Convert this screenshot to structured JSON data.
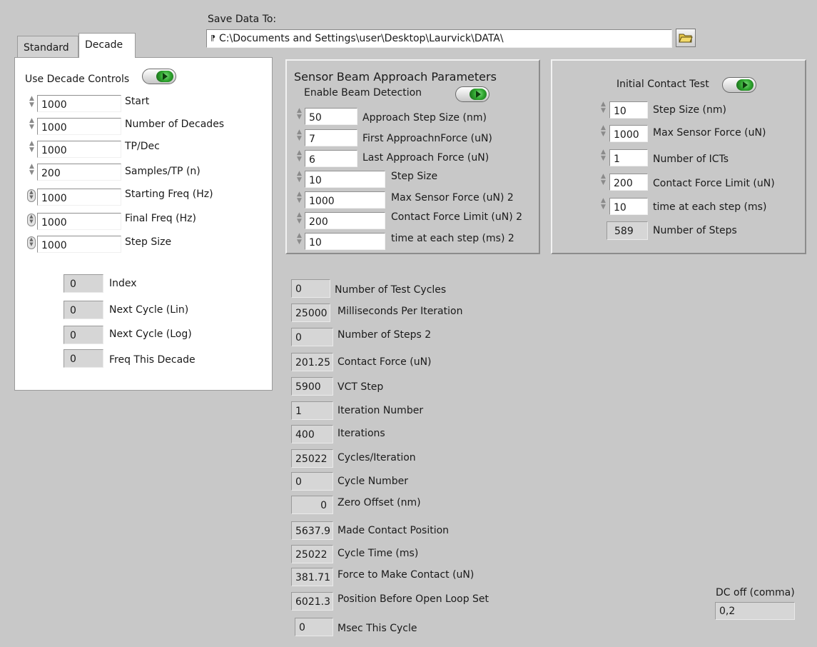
{
  "save": {
    "label": "Save Data To:",
    "path_icon": "path-icon",
    "path": "C:\\Documents and Settings\\user\\Desktop\\Laurvick\\DATA\\",
    "browse_icon": "folder-icon"
  },
  "tabs": [
    {
      "label": "Standard",
      "selected": false
    },
    {
      "label": "Decade",
      "selected": true
    }
  ],
  "decade": {
    "use_label": "Use Decade Controls",
    "controls": [
      {
        "value": "1000",
        "label": "Start"
      },
      {
        "value": "1000",
        "label": "Number of Decades"
      },
      {
        "value": "1000",
        "label": "TP/Dec"
      },
      {
        "value": "200",
        "label": "Samples/TP (n)"
      },
      {
        "value": "1000",
        "label": "Starting Freq (Hz)"
      },
      {
        "value": "1000",
        "label": "Final Freq (Hz)"
      },
      {
        "value": "1000",
        "label": "Step Size"
      }
    ],
    "indicators": [
      {
        "value": "0",
        "label": "Index"
      },
      {
        "value": "0",
        "label": "Next Cycle (Lin)"
      },
      {
        "value": "0",
        "label": "Next Cycle (Log)"
      },
      {
        "value": "0",
        "label": "Freq This Decade"
      }
    ]
  },
  "sensor": {
    "title": "Sensor Beam Approach  Parameters",
    "enable_label": "Enable Beam Detection",
    "controls": [
      {
        "value": "50",
        "label": "Approach Step Size (nm)"
      },
      {
        "value": "7",
        "label": "First ApproachnForce (uN)"
      },
      {
        "value": "6",
        "label": "Last Approach Force (uN)"
      },
      {
        "value": "10",
        "label": "Step Size"
      },
      {
        "value": "1000",
        "label": "Max Sensor Force (uN) 2"
      },
      {
        "value": "200",
        "label": "Contact Force Limit (uN) 2"
      },
      {
        "value": "10",
        "label": "time at each step (ms) 2"
      }
    ]
  },
  "ict": {
    "title": "Initial Contact Test",
    "controls": [
      {
        "value": "10",
        "label": "Step Size (nm)"
      },
      {
        "value": "1000",
        "label": "Max Sensor Force (uN)"
      },
      {
        "value": "1",
        "label": "Number of ICTs"
      },
      {
        "value": "200",
        "label": "Contact Force Limit (uN)"
      },
      {
        "value": "10",
        "label": "time at each step (ms)"
      }
    ],
    "steps": {
      "value": "589",
      "label": "Number of Steps"
    }
  },
  "status": [
    {
      "value": "0",
      "label": "Number of Test Cycles"
    },
    {
      "value": "25000",
      "label": "Milliseconds Per Iteration"
    },
    {
      "value": "0",
      "label": "Number of Steps 2"
    },
    {
      "value": "201.25",
      "label": "Contact Force (uN)"
    },
    {
      "value": "5900",
      "label": "VCT Step"
    },
    {
      "value": "1",
      "label": "Iteration Number"
    },
    {
      "value": "400",
      "label": "Iterations"
    },
    {
      "value": "25022",
      "label": "Cycles/Iteration"
    },
    {
      "value": "0",
      "label": "Cycle Number"
    },
    {
      "value": "0",
      "label": "Zero Offset (nm)"
    },
    {
      "value": "5637.9",
      "label": "Made Contact Position"
    },
    {
      "value": "25022",
      "label": "Cycle Time (ms)"
    },
    {
      "value": "381.71",
      "label": "Force to Make Contact (uN)"
    },
    {
      "value": "6021.3",
      "label": "Position Before Open Loop Set"
    },
    {
      "value": "0",
      "label": "Msec This Cycle"
    }
  ],
  "dc": {
    "label": "DC off (comma)",
    "value": "0,2"
  }
}
